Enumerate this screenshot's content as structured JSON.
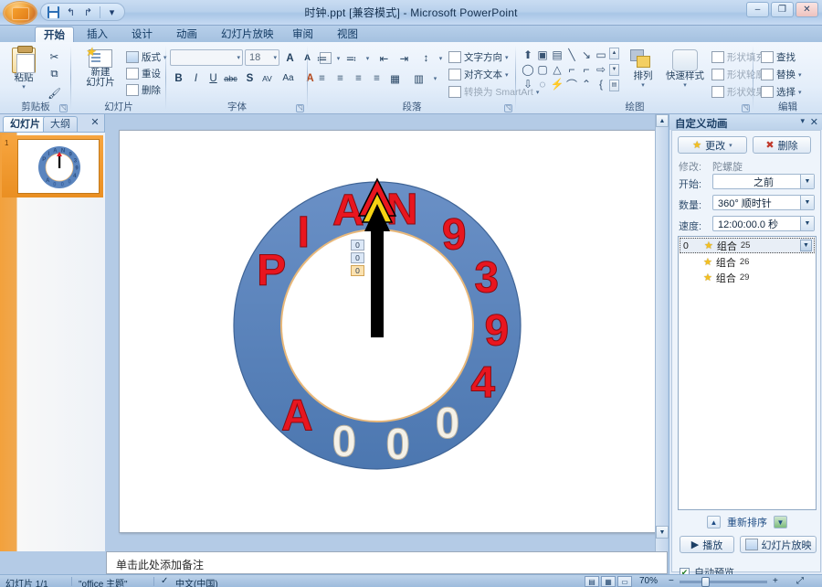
{
  "window": {
    "title": "时钟.ppt [兼容模式] - Microsoft PowerPoint",
    "minimize": "–",
    "restore": "❐",
    "close": "✕"
  },
  "quick_access": {
    "save": "save-icon",
    "undo": "↰",
    "redo": "↱",
    "customize": "▾"
  },
  "tabs": [
    {
      "label": "开始",
      "active": true
    },
    {
      "label": "插入",
      "active": false
    },
    {
      "label": "设计",
      "active": false
    },
    {
      "label": "动画",
      "active": false
    },
    {
      "label": "幻灯片放映",
      "active": false
    },
    {
      "label": "审阅",
      "active": false
    },
    {
      "label": "视图",
      "active": false
    }
  ],
  "ribbon": {
    "clipboard": {
      "group_label": "剪贴板",
      "paste": "粘贴",
      "cut": "✂",
      "copy": "⧉",
      "format_painter": "🖌"
    },
    "slides": {
      "group_label": "幻灯片",
      "new_slide": "新建\n幻灯片",
      "new_slide_line1": "新建",
      "new_slide_line2": "幻灯片",
      "layout": "版式",
      "reset": "重设",
      "delete": "删除"
    },
    "font": {
      "group_label": "字体",
      "font_name": "",
      "font_size": "18",
      "grow": "A",
      "shrink": "A",
      "clear_format": "Aa",
      "bold": "B",
      "italic": "I",
      "underline": "U",
      "strikethrough": "abc",
      "shadow": "S",
      "spacing": "AV",
      "change_case": "Aa",
      "font_color": "A"
    },
    "paragraph": {
      "group_label": "段落",
      "bullets": "≔",
      "numbering": "≕",
      "dec_indent": "⇤",
      "inc_indent": "⇥",
      "line_spacing": "↕",
      "align_left": "≡",
      "align_center": "≡",
      "align_right": "≡",
      "justify": "≡",
      "columns": "▥",
      "text_direction": "文字方向",
      "align_text": "对齐文本",
      "convert_smartart": "转换为 SmartArt"
    },
    "drawing": {
      "group_label": "绘图",
      "arrange": "排列",
      "quick_styles": "快速样式",
      "shape_fill": "形状填充",
      "shape_outline": "形状轮廓",
      "shape_effects": "形状效果",
      "shapes": [
        "⬆",
        "▣",
        "▤",
        "╲",
        "↘",
        "▭",
        "◯",
        "▢",
        "△",
        "⌐",
        "⌐",
        "⇨",
        "⇩",
        "◌",
        "⚡",
        "⌒",
        "⌃",
        "{"
      ]
    },
    "editing": {
      "group_label": "编辑",
      "find": "查找",
      "replace": "替换",
      "select": "选择"
    }
  },
  "left_pane": {
    "tab_slides": "幻灯片",
    "tab_outline": "大纲",
    "close": "✕",
    "slide_number": "1"
  },
  "notes": {
    "placeholder": "单击此处添加备注"
  },
  "task_pane": {
    "title": "自定义动画",
    "close": "✕",
    "dropdown": "▾",
    "change_button": "更改",
    "remove_button": "删除",
    "modify_label": "修改:",
    "modify_effect": "陀螺旋",
    "start_label": "开始:",
    "start_value": "之前",
    "amount_label": "数量:",
    "amount_value": "360°   顺时针",
    "speed_label": "速度:",
    "speed_value": "12:00:00.0 秒",
    "animations": [
      {
        "index": "0",
        "name": "组合",
        "number": "25",
        "selected": true
      },
      {
        "index": "",
        "name": "组合",
        "number": "26",
        "selected": false
      },
      {
        "index": "",
        "name": "组合",
        "number": "29",
        "selected": false
      }
    ],
    "reorder_label": "重新排序",
    "reorder_up": "▲",
    "reorder_down": "▼",
    "play_button": "播放",
    "slideshow_button": "幻灯片放映",
    "autopreview_label": "自动预览",
    "autopreview_checked": "✔"
  },
  "slide": {
    "ring_color": "#5b85be",
    "ring_edge_color": "#e8b87a",
    "red": "#e8161f",
    "white": "#f4f1e8",
    "ring_items": [
      {
        "char": "P",
        "angle": -62,
        "color": "red"
      },
      {
        "char": "I",
        "angle": -38,
        "color": "red"
      },
      {
        "char": "A",
        "angle": -14,
        "color": "red"
      },
      {
        "char": "N",
        "angle": 12,
        "color": "red"
      },
      {
        "char": "9",
        "angle": 40,
        "color": "red"
      },
      {
        "char": "3",
        "angle": 66,
        "color": "red"
      },
      {
        "char": "9",
        "angle": 92,
        "color": "red"
      },
      {
        "char": "4",
        "angle": 118,
        "color": "red"
      },
      {
        "char": "0",
        "angle": 144,
        "color": "white"
      },
      {
        "char": "0",
        "angle": 170,
        "color": "white"
      },
      {
        "char": "0",
        "angle": 196,
        "color": "white"
      },
      {
        "char": "A",
        "angle": 222,
        "color": "red"
      }
    ],
    "animation_tags": [
      {
        "value": "0",
        "style": "blue"
      },
      {
        "value": "0",
        "style": "blue"
      },
      {
        "value": "0",
        "style": "orange"
      }
    ]
  },
  "status_bar": {
    "slide_count": "幻灯片 1/1",
    "theme": "\"office 主题\"",
    "language": "中文(中国)",
    "zoom": "70%",
    "view_normal": "▤",
    "view_sorter": "▦",
    "view_show": "▭",
    "zoom_out": "−",
    "zoom_in": "+",
    "fit": "⤢"
  }
}
